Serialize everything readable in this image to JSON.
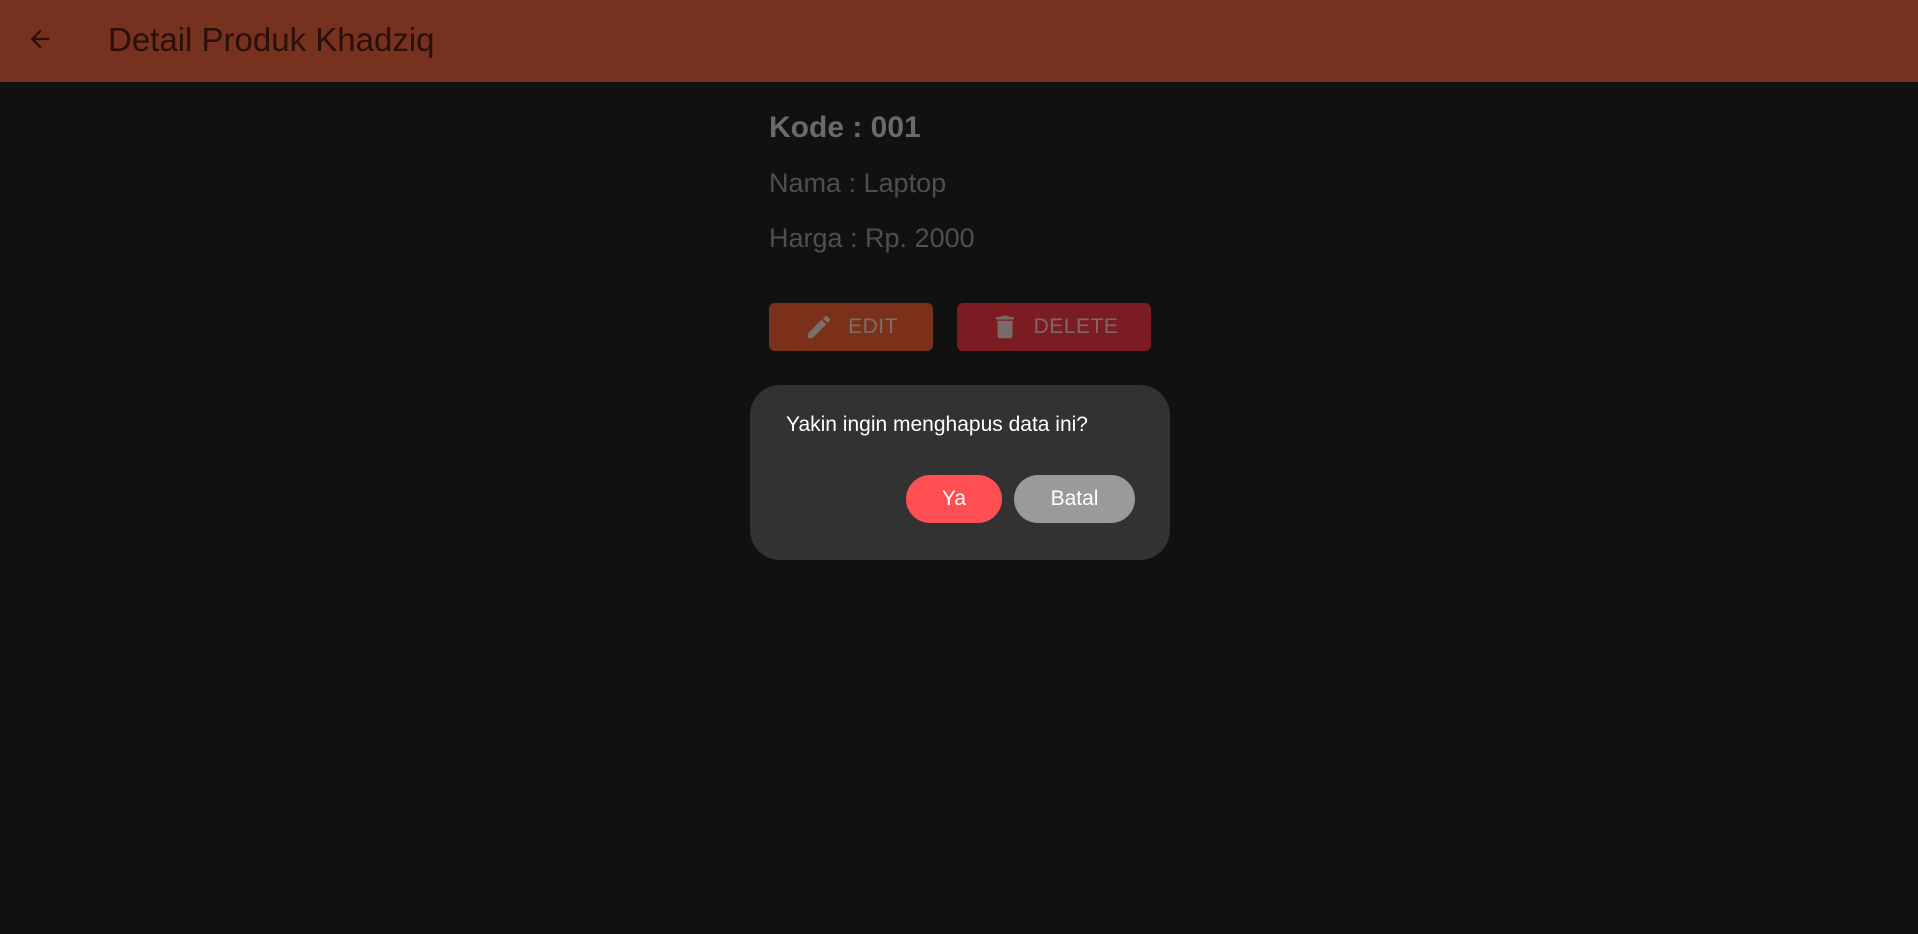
{
  "appbar": {
    "title": "Detail Produk Khadziq",
    "back_icon": "arrow-back-icon",
    "color": "#76321e"
  },
  "product": {
    "kode": "Kode : 001",
    "nama": "Nama : Laptop",
    "harga": "Harga : Rp. 2000"
  },
  "actions": {
    "edit_label": "EDIT",
    "edit_icon": "pencil-icon",
    "delete_label": "DELETE",
    "delete_icon": "trash-icon"
  },
  "dialog": {
    "message": "Yakin ingin menghapus data ini?",
    "confirm_label": "Ya",
    "cancel_label": "Batal",
    "confirm_color": "#ff4f52",
    "cancel_color": "#9a9a9a"
  }
}
